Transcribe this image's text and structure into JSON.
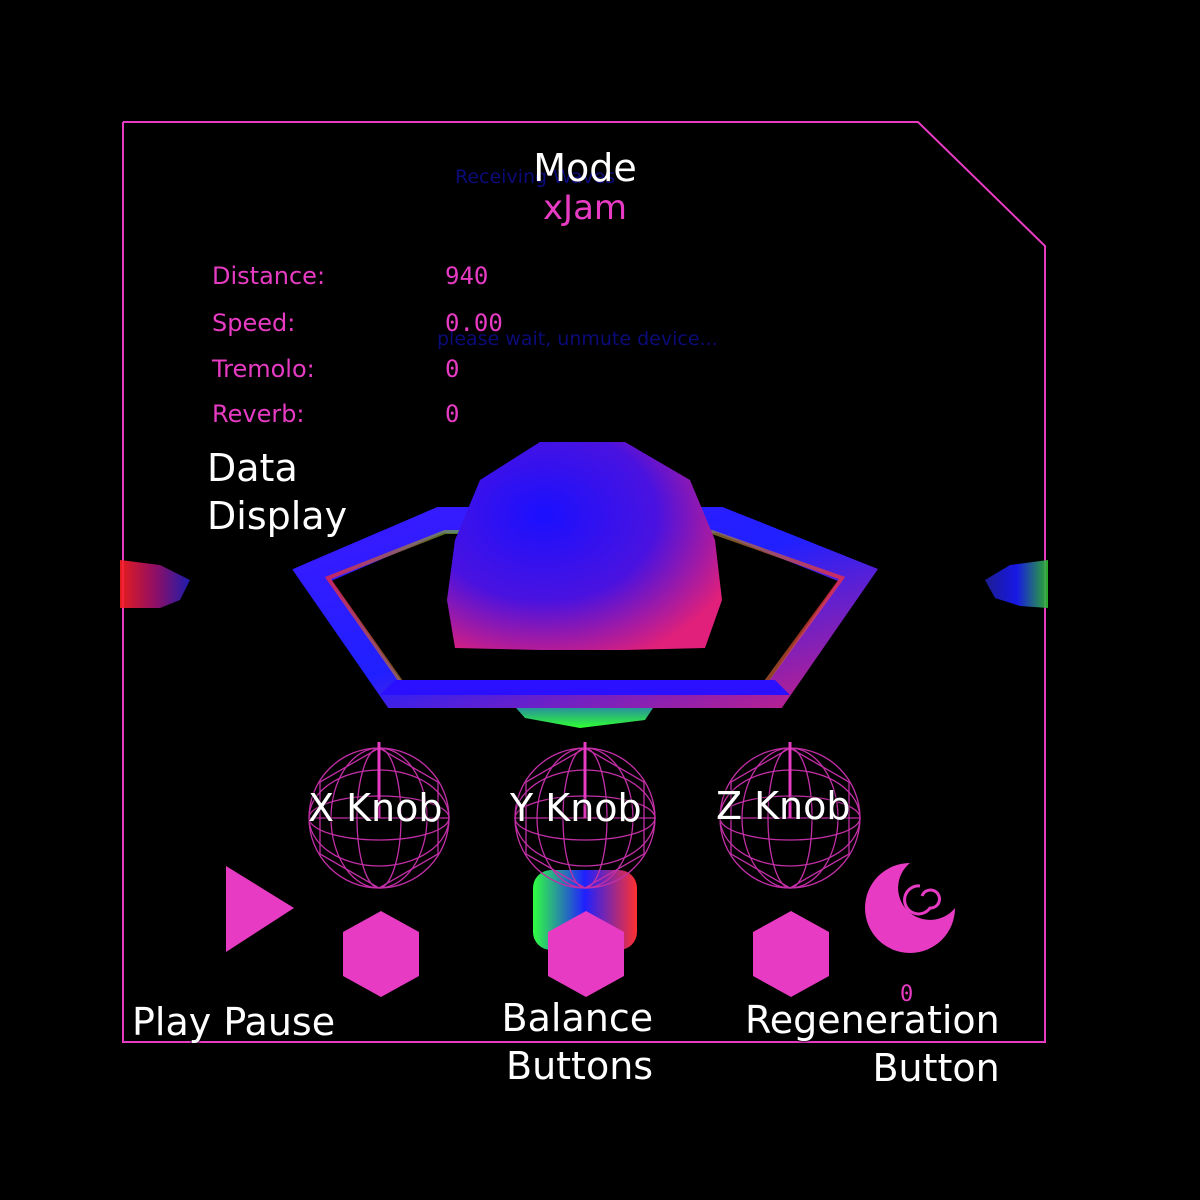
{
  "overlay": {
    "receiving_text": "Receiving Waves",
    "unmute_text": "please wait, unmute device..."
  },
  "mode": {
    "label": "Mode",
    "value": "xJam"
  },
  "stats": [
    {
      "label": "Distance:",
      "value": "940"
    },
    {
      "label": "Speed:",
      "value": "0.00"
    },
    {
      "label": "Tremolo:",
      "value": "0"
    },
    {
      "label": "Reverb:",
      "value": "0"
    }
  ],
  "annotations": {
    "data_display": [
      "Data",
      "Display"
    ],
    "play_pause": "Play Pause",
    "balance_buttons": [
      "Balance",
      "Buttons"
    ],
    "regeneration_button": [
      "Regeneration",
      "Button"
    ]
  },
  "knobs": [
    {
      "label": "X Knob"
    },
    {
      "label": "Y Knob"
    },
    {
      "label": "Z Knob"
    }
  ],
  "regeneration_count": "0",
  "colors": {
    "accent": "#e83bc4",
    "background": "#000000",
    "faint_text": "#0b0b7a"
  },
  "icons": [
    "play-icon",
    "hexagon-button-icon",
    "crescent-swirl-icon",
    "wireframe-sphere-knob-icon"
  ]
}
